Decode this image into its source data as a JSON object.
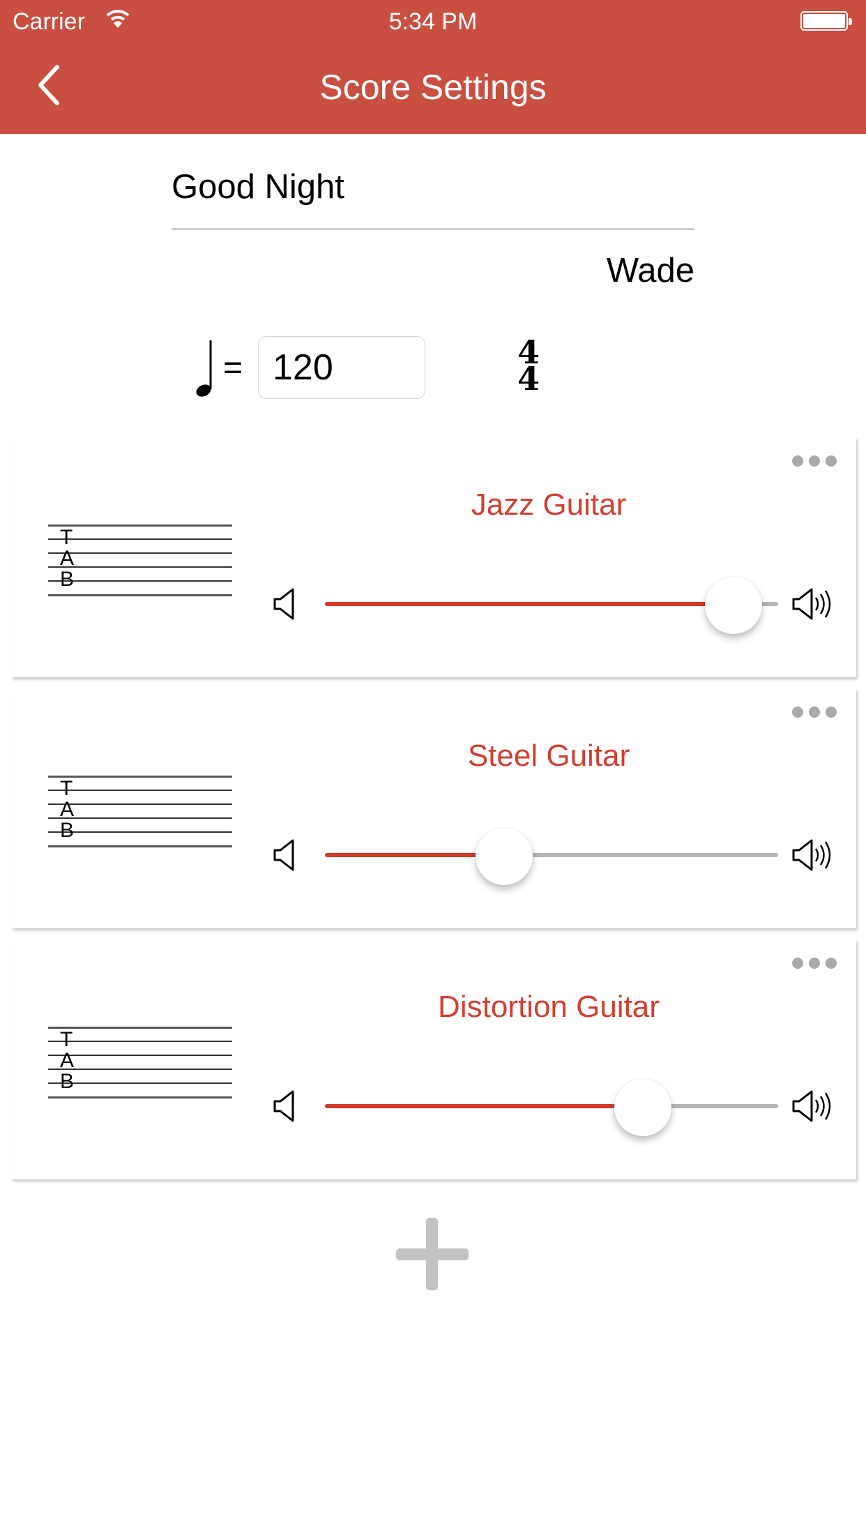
{
  "status_bar": {
    "carrier": "Carrier",
    "time": "5:34 PM"
  },
  "header": {
    "title": "Score Settings",
    "back_icon": "chevron-left-icon"
  },
  "score": {
    "title": "Good Night",
    "composer": "Wade",
    "tempo_symbol": "=",
    "tempo": "120",
    "time_signature": {
      "numerator": "4",
      "denominator": "4"
    }
  },
  "tab_labels": [
    "T",
    "A",
    "B"
  ],
  "tracks": [
    {
      "name": "Jazz Guitar",
      "volume": 0.96
    },
    {
      "name": "Steel Guitar",
      "volume": 0.38
    },
    {
      "name": "Distortion Guitar",
      "volume": 0.73
    }
  ],
  "colors": {
    "header": "#c94f40",
    "accent": "#d43a2b",
    "track_empty": "#b5b5b5",
    "add_button": "#c3c3c3"
  }
}
